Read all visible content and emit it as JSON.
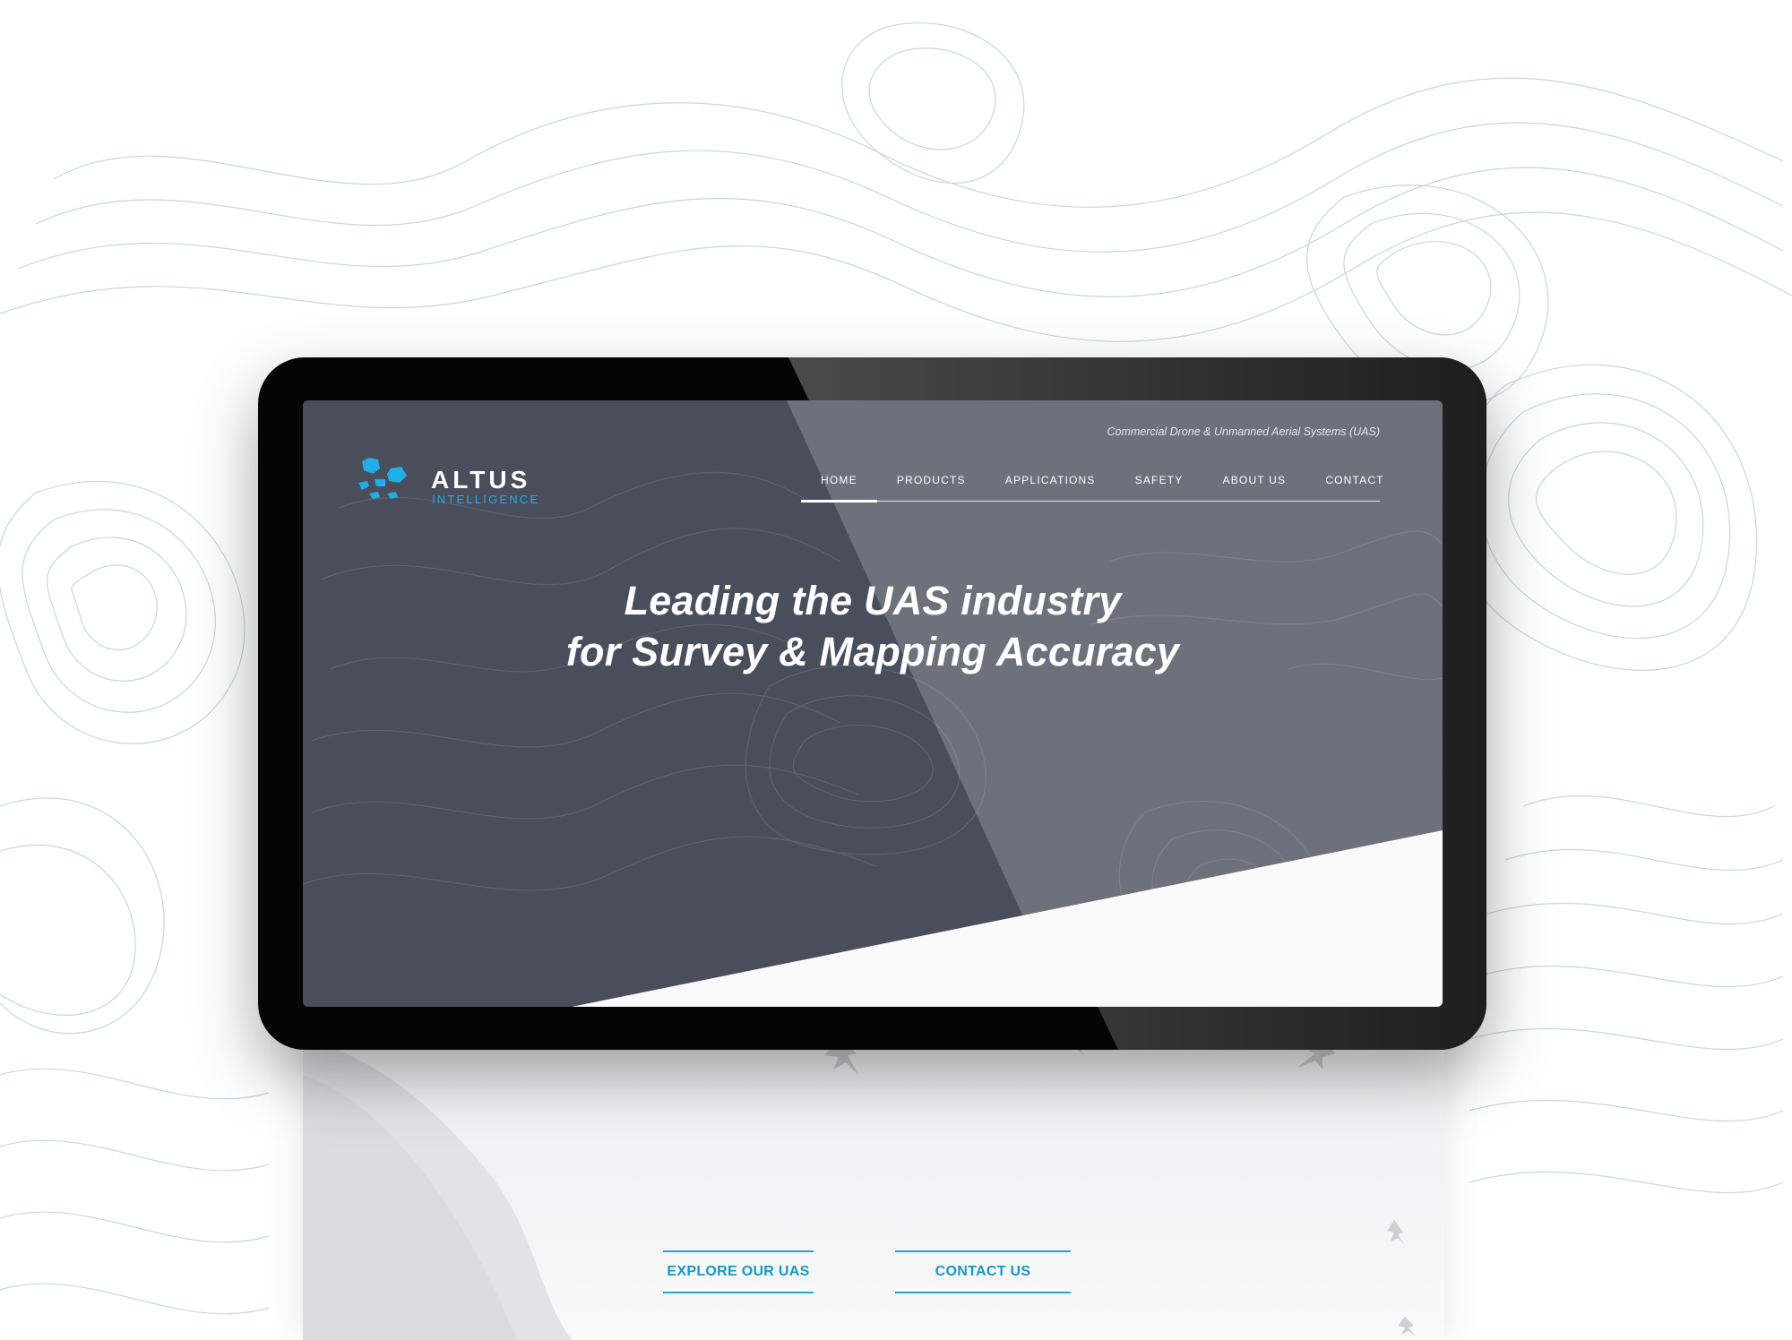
{
  "site": {
    "tagline": "Commercial Drone & Unmanned Aerial Systems (UAS)",
    "logo": {
      "word": "ALTUS",
      "sub": "INTELLIGENCE"
    }
  },
  "nav": {
    "items": [
      {
        "label": "HOME",
        "active": true
      },
      {
        "label": "PRODUCTS",
        "active": false
      },
      {
        "label": "APPLICATIONS",
        "active": false
      },
      {
        "label": "SAFETY",
        "active": false
      },
      {
        "label": "ABOUT US",
        "active": false
      },
      {
        "label": "CONTACT",
        "active": false
      }
    ]
  },
  "hero": {
    "line1": "Leading the UAS industry",
    "line2": "for Survey & Mapping Accuracy"
  },
  "cta": {
    "explore": "EXPLORE OUR UAS",
    "contact": "CONTACT US"
  },
  "colors": {
    "accent": "#1fa6d6",
    "hero_bg": "#4a4d5c",
    "device": "#050505"
  }
}
